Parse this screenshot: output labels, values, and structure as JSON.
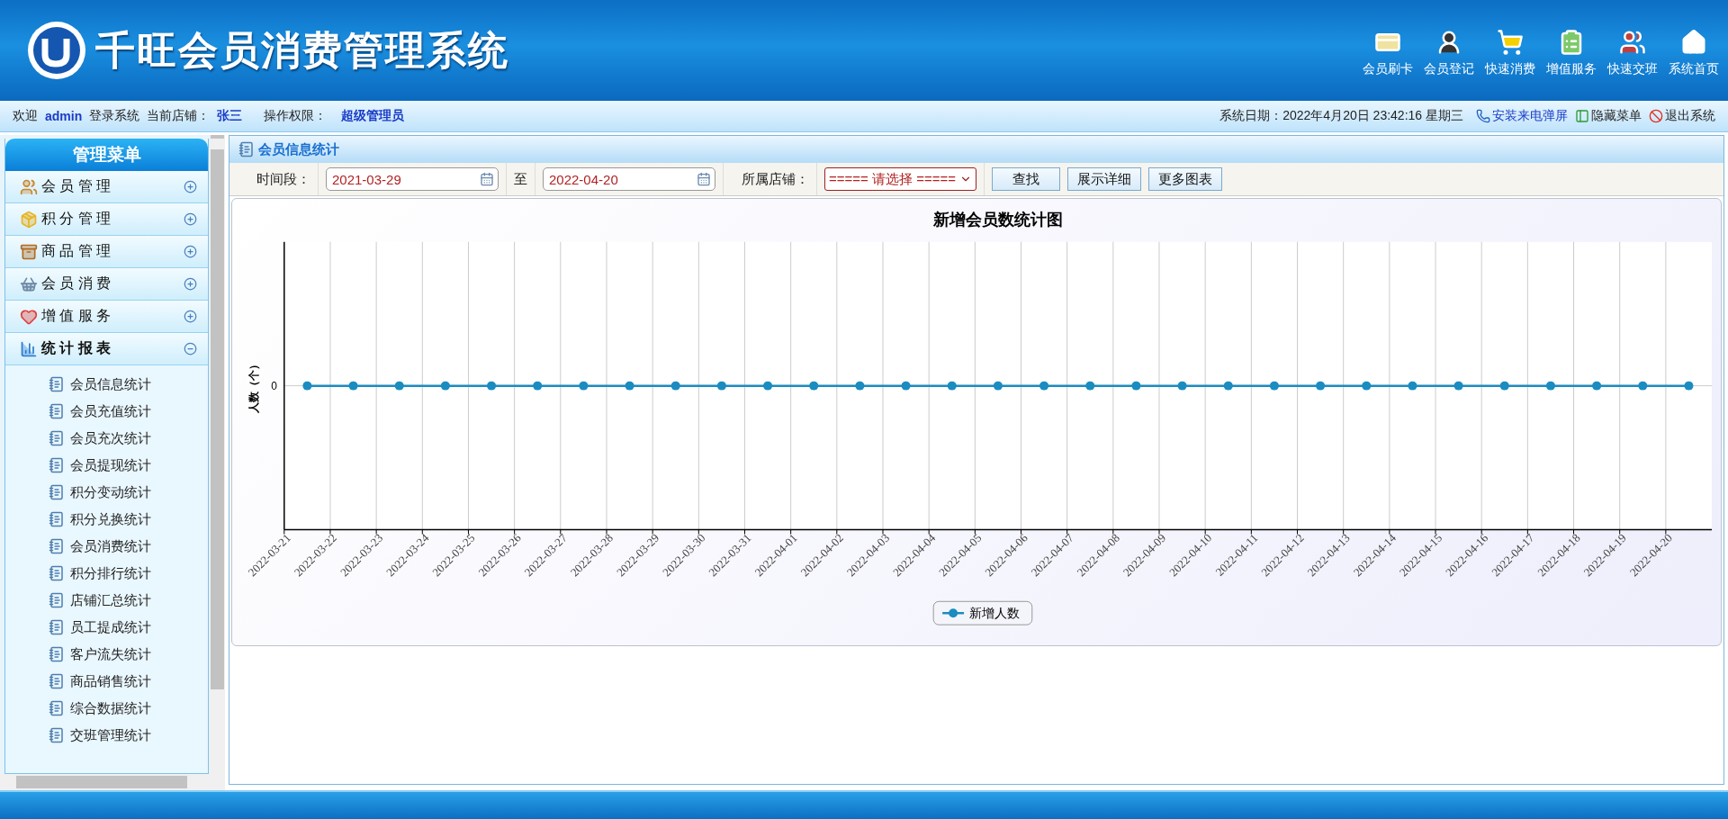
{
  "header": {
    "title": "千旺会员消费管理系统",
    "nav": [
      {
        "label": "会员刷卡"
      },
      {
        "label": "会员登记"
      },
      {
        "label": "快速消费"
      },
      {
        "label": "增值服务"
      },
      {
        "label": "快速交班"
      },
      {
        "label": "系统首页"
      }
    ]
  },
  "info_bar": {
    "welcome": "欢迎",
    "user": "admin",
    "login_text": "登录系统",
    "store_label": "当前店铺：",
    "store": "张三",
    "role_label": "操作权限：",
    "role": "超级管理员",
    "date": "系统日期：2022年4月20日 23:42:16 星期三",
    "links": [
      {
        "label": "安装来电弹屏"
      },
      {
        "label": "隐藏菜单"
      },
      {
        "label": "退出系统"
      }
    ]
  },
  "sidebar": {
    "title": "管理菜单",
    "items": [
      {
        "label": "会 员 管 理",
        "expanded": false
      },
      {
        "label": "积 分 管 理",
        "expanded": false
      },
      {
        "label": "商 品 管 理",
        "expanded": false
      },
      {
        "label": "会 员 消 费",
        "expanded": false
      },
      {
        "label": "增 值 服 务",
        "expanded": false
      },
      {
        "label": "统 计 报 表",
        "expanded": true,
        "children": [
          {
            "label": "会员信息统计"
          },
          {
            "label": "会员充值统计"
          },
          {
            "label": "会员充次统计"
          },
          {
            "label": "会员提现统计"
          },
          {
            "label": "积分变动统计"
          },
          {
            "label": "积分兑换统计"
          },
          {
            "label": "会员消费统计"
          },
          {
            "label": "积分排行统计"
          },
          {
            "label": "店铺汇总统计"
          },
          {
            "label": "员工提成统计"
          },
          {
            "label": "客户流失统计"
          },
          {
            "label": "商品销售统计"
          },
          {
            "label": "综合数据统计"
          },
          {
            "label": "交班管理统计"
          }
        ]
      }
    ]
  },
  "page": {
    "title": "会员信息统计"
  },
  "filters": {
    "period_label": "时间段：",
    "start": "2021-03-29",
    "to_label": "至",
    "end": "2022-04-20",
    "store_label": "所属店铺：",
    "store_select": "===== 请选择 =====",
    "buttons": [
      "查找",
      "展示详细",
      "更多图表"
    ]
  },
  "chart": {
    "title": "新增会员数统计图",
    "ylabel": "人数（个）",
    "y_tick": "0",
    "legend": "新增人数",
    "dates": [
      "2022-03-21",
      "2022-03-22",
      "2022-03-23",
      "2022-03-24",
      "2022-03-25",
      "2022-03-26",
      "2022-03-27",
      "2022-03-28",
      "2022-03-29",
      "2022-03-30",
      "2022-03-31",
      "2022-04-01",
      "2022-04-02",
      "2022-04-03",
      "2022-04-04",
      "2022-04-05",
      "2022-04-06",
      "2022-04-07",
      "2022-04-08",
      "2022-04-09",
      "2022-04-10",
      "2022-04-11",
      "2022-04-12",
      "2022-04-13",
      "2022-04-14",
      "2022-04-15",
      "2022-04-16",
      "2022-04-17",
      "2022-04-18",
      "2022-04-19",
      "2022-04-20"
    ]
  }
}
